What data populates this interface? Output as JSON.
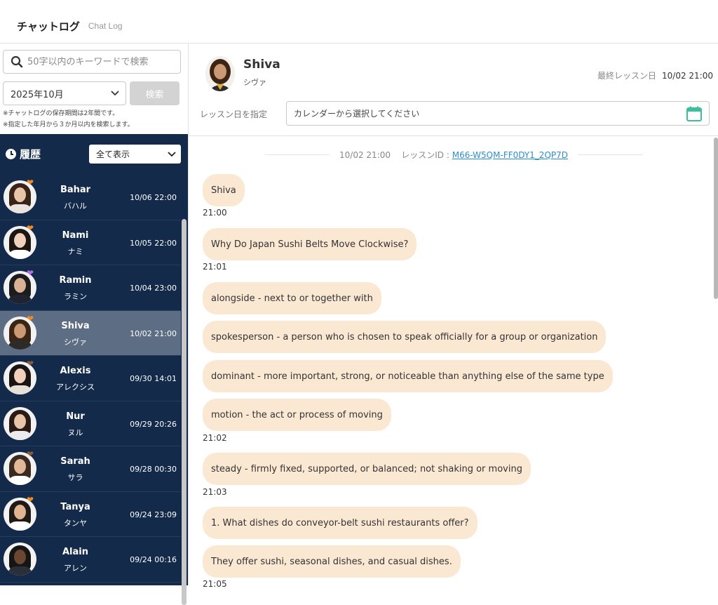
{
  "header": {
    "title": "チャットログ",
    "subtitle": "Chat Log"
  },
  "search": {
    "placeholder": "50字以内のキーワードで検索",
    "month": "2025年10月",
    "button": "検索",
    "note1": "※チャットログの保存期間は2年間です。",
    "note2": "※指定した年月から３か月以内を検索します。"
  },
  "history": {
    "title": "履歴",
    "filter": "全て表示",
    "tutors": [
      {
        "name": "Bahar",
        "kana": "バハル",
        "date": "10/06 22:00",
        "heart": "#f08a24",
        "hair": "#3a2418",
        "skin": "#e8c4a8",
        "shirt": "#e9e4df"
      },
      {
        "name": "Nami",
        "kana": "ナミ",
        "date": "10/05 22:00",
        "heart": "#f08a24",
        "hair": "#1e1612",
        "skin": "#f0d2bc",
        "shirt": "#ffffff"
      },
      {
        "name": "Ramin",
        "kana": "ラミン",
        "date": "10/04 23:00",
        "heart": "#b06ee8",
        "hair": "#1c1c1c",
        "skin": "#d7b096",
        "shirt": "#1f2430"
      },
      {
        "name": "Shiva",
        "kana": "シヴァ",
        "date": "10/02 21:00",
        "heart": "#f08a24",
        "hair": "#3b2616",
        "skin": "#c99a74",
        "shirt": "#2d2a2a"
      },
      {
        "name": "Alexis",
        "kana": "アレクシス",
        "date": "09/30 14:01",
        "heart": "#8b5a3c",
        "hair": "#1a1413",
        "skin": "#f0d2bc",
        "shirt": "#e8dfd9"
      },
      {
        "name": "Nur",
        "kana": "ヌル",
        "date": "09/29 20:26",
        "heart": "",
        "hair": "#2a1c14",
        "skin": "#e8c4a8",
        "shirt": "#ececec"
      },
      {
        "name": "Sarah",
        "kana": "サラ",
        "date": "09/28 00:30",
        "heart": "#8b5a3c",
        "hair": "#3a2a1f",
        "skin": "#e3b898",
        "shirt": "#ffffff"
      },
      {
        "name": "Tanya",
        "kana": "タンヤ",
        "date": "09/24 23:09",
        "heart": "#f08a24",
        "hair": "#1f1a16",
        "skin": "#e0b490",
        "shirt": "#ffffff"
      },
      {
        "name": "Alain",
        "kana": "アレン",
        "date": "09/24 00:16",
        "heart": "",
        "hair": "#151515",
        "skin": "#6b4630",
        "shirt": "#2b2f3a"
      }
    ],
    "active_index": 3
  },
  "detail": {
    "name": "Shiva",
    "kana": "シヴァ",
    "last_lesson_label": "最終レッスン日",
    "last_lesson_value": "10/02 21:00",
    "date_label": "レッスン日を指定",
    "date_placeholder": "カレンダーから選択してください",
    "session_time": "10/02 21:00",
    "lesson_id_label": "レッスンID :",
    "lesson_id": "M66-W5QM-FF0DY1_2QP7D",
    "accent": "#3cbf9f"
  },
  "messages": [
    {
      "text": "Shiva",
      "time": "21:00"
    },
    {
      "text": "Why Do Japan Sushi Belts Move Clockwise?",
      "time": "21:01"
    },
    {
      "text": "alongside - next to or together with",
      "time": ""
    },
    {
      "text": "spokesperson - a person who is chosen to speak officially for a group or organization",
      "time": ""
    },
    {
      "text": "dominant - more important, strong, or noticeable than anything else of the same type",
      "time": ""
    },
    {
      "text": "motion - the act or process of moving",
      "time": "21:02"
    },
    {
      "text": "steady - firmly fixed, supported, or balanced; not shaking or moving",
      "time": "21:03"
    },
    {
      "text": "1. What dishes do conveyor-belt sushi restaurants offer?",
      "time": ""
    },
    {
      "text": "They offer sushi, seasonal dishes, and casual dishes.",
      "time": "21:05"
    }
  ]
}
